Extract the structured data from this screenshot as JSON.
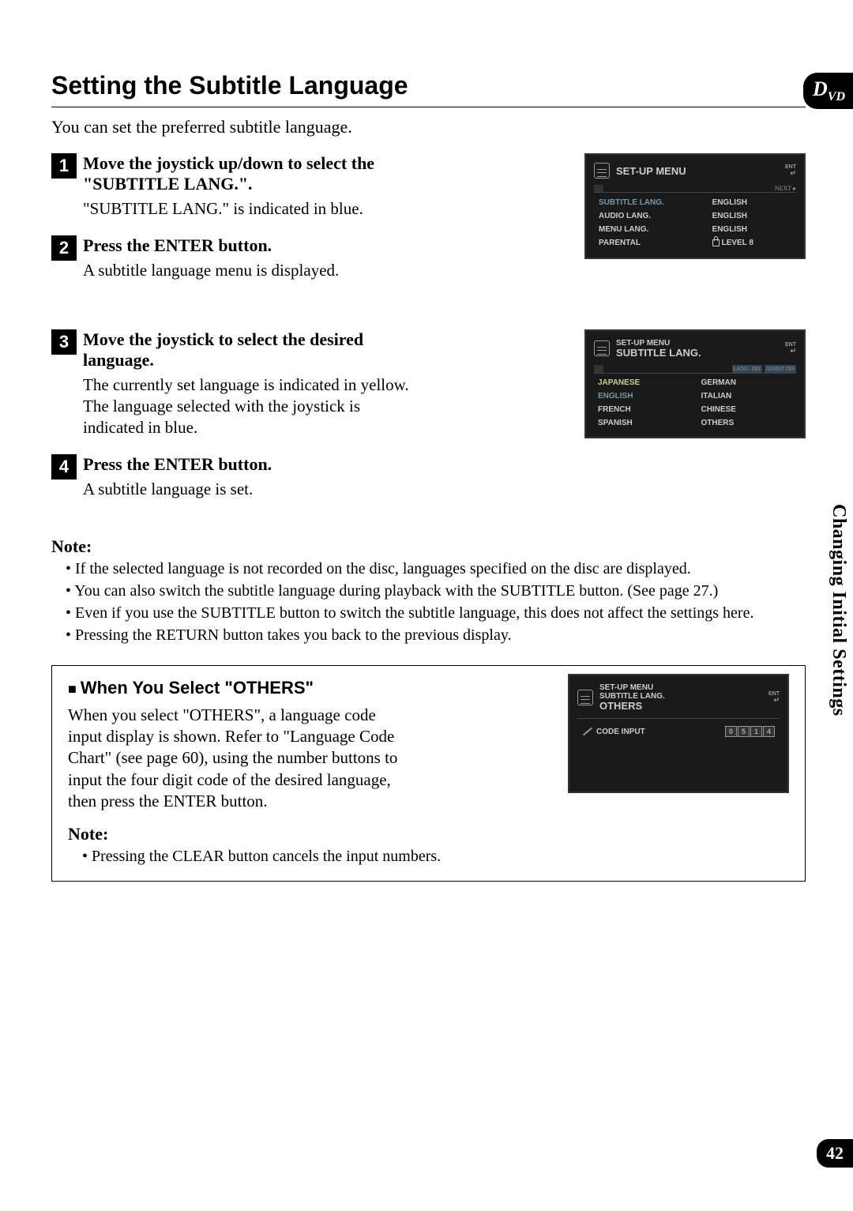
{
  "badge": {
    "letter": "D",
    "sub": "VD"
  },
  "title": "Setting the Subtitle Language",
  "intro": "You can set the preferred subtitle language.",
  "steps": [
    {
      "num": "1",
      "title": "Move the joystick up/down to select the \"SUBTITLE LANG.\".",
      "desc": "\"SUBTITLE LANG.\" is indicated in blue."
    },
    {
      "num": "2",
      "title": "Press the ENTER button.",
      "desc": "A subtitle language menu is displayed."
    },
    {
      "num": "3",
      "title": "Move the joystick to select the desired language.",
      "desc": "The currently set language is indicated in yellow. The language selected with the joystick is indicated in blue."
    },
    {
      "num": "4",
      "title": "Press the ENTER button.",
      "desc": "A subtitle language is set."
    }
  ],
  "note1": {
    "label": "Note:",
    "items": [
      "If the selected language is not recorded on the disc, languages specified on the disc are displayed.",
      "You can also switch the subtitle language during playback with the SUBTITLE button. (See page 27.)",
      "Even if you use the SUBTITLE button to switch the subtitle language, this does not affect the settings here.",
      "Pressing the RETURN button takes you back to the previous display."
    ]
  },
  "others": {
    "title": "When You Select \"OTHERS\"",
    "text": "When you select \"OTHERS\", a language code input display is shown. Refer to \"Language Code Chart\" (see page 60), using the number buttons to input the four digit code of the desired language, then press the ENTER button.",
    "note_label": "Note:",
    "note_items": [
      "Pressing the CLEAR button cancels the input numbers."
    ]
  },
  "screen1": {
    "title": "SET-UP MENU",
    "ent": "ENT",
    "arrow": "↵",
    "next": "NEXT ▸",
    "rows": [
      {
        "label": "SUBTITLE LANG.",
        "value": "ENGLISH",
        "highlight": "blue"
      },
      {
        "label": "AUDIO LANG.",
        "value": "ENGLISH"
      },
      {
        "label": "MENU LANG.",
        "value": "ENGLISH"
      },
      {
        "label": "PARENTAL",
        "value": "LEVEL 8",
        "lock": true
      }
    ]
  },
  "screen2": {
    "pre": "SET-UP MENU",
    "title": "SUBTITLE LANG.",
    "ent": "ENT",
    "arrow": "↵",
    "tab1": "LANG. DIS",
    "tab2": "ASSIST DIS",
    "langs": [
      {
        "name": "JAPANESE",
        "style": "selected"
      },
      {
        "name": "GERMAN"
      },
      {
        "name": "ENGLISH",
        "style": "blue"
      },
      {
        "name": "ITALIAN"
      },
      {
        "name": "FRENCH"
      },
      {
        "name": "CHINESE"
      },
      {
        "name": "SPANISH"
      },
      {
        "name": "OTHERS"
      }
    ]
  },
  "screen3": {
    "pre1": "SET-UP MENU",
    "pre2": "SUBTITLE LANG.",
    "title": "OTHERS",
    "ent": "ENT",
    "arrow": "↵",
    "code_label": "CODE INPUT",
    "code": [
      "0",
      "5",
      "1",
      "4"
    ]
  },
  "side_text": "Changing Initial Settings",
  "page_number": "42"
}
